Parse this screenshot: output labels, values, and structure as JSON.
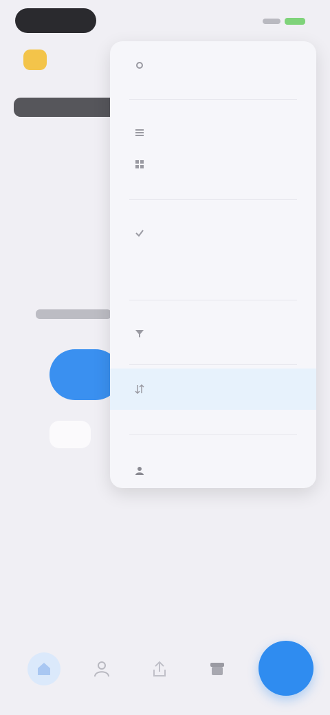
{
  "menu": {
    "items": [
      {
        "label": "",
        "icon": "settings-icon"
      },
      {
        "label": "",
        "icon": "list-icon"
      },
      {
        "label": "",
        "icon": "grid-icon"
      },
      {
        "label": "",
        "icon": "check-icon"
      },
      {
        "label": "",
        "icon": ""
      },
      {
        "label": "",
        "icon": "filter-icon"
      },
      {
        "label": "",
        "icon": "sort-icon"
      },
      {
        "label": "",
        "icon": "people-icon"
      }
    ]
  },
  "tabs": [
    "home-icon",
    "person-icon",
    "share-icon",
    "archive-icon"
  ],
  "colors": {
    "accent": "#2f8cf0",
    "background": "#f0eff4",
    "menu_selected": "#e7f2fc"
  }
}
